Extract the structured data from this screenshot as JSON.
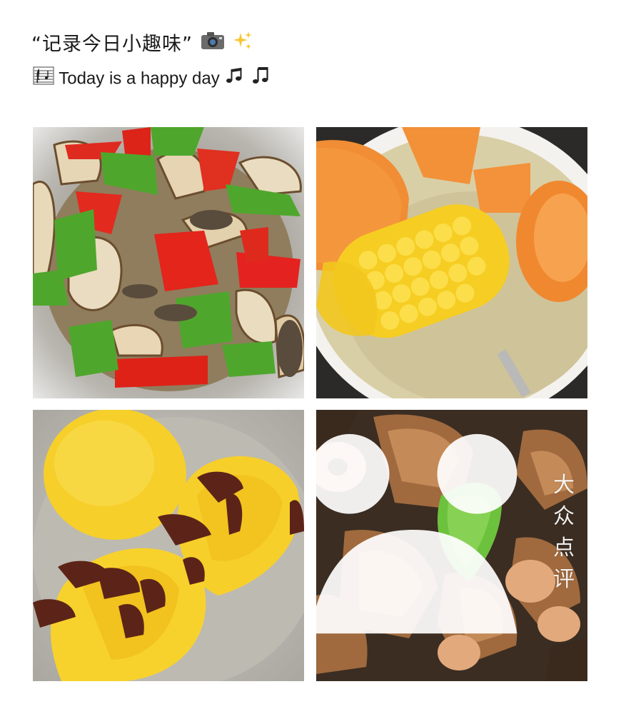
{
  "post": {
    "title": "“记录今日小趣味”",
    "subtitle": "Today is a happy day",
    "title_icons": [
      "camera-icon",
      "sparkles-icon"
    ],
    "subtitle_icons": [
      "musical-score-icon",
      "musical-notes-icon",
      "musical-note-icon"
    ]
  },
  "photos": [
    {
      "subject": "stir-fried mushrooms with peppers"
    },
    {
      "subject": "corn and carrot soup"
    },
    {
      "subject": "steamed corn buns with dried chili rolls"
    },
    {
      "subject": "braised beef ribs with green pepper"
    }
  ],
  "watermark": {
    "text": "大众点评",
    "icon": "dianping-logo-icon"
  }
}
